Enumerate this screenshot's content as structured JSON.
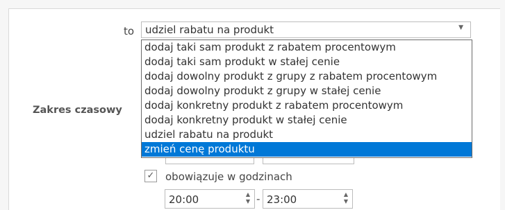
{
  "rule": {
    "to_label": "to",
    "selected_action": "udziel rabatu na produkt",
    "options": [
      "dodaj taki sam produkt z rabatem procentowym",
      "dodaj taki sam produkt w stałej cenie",
      "dodaj dowolny produkt z grupy z rabatem procentowym",
      "dodaj dowolny produkt z grupy w stałej cenie",
      "dodaj konkretny produkt z rabatem procentowym",
      "dodaj konkretny produkt w stałej cenie",
      "udziel rabatu na produkt",
      "zmień cenę produktu"
    ],
    "highlighted_index": 7
  },
  "time_range": {
    "label": "Zakres czasowy",
    "hours_checkbox_label": "obowiązuje w godzinach",
    "hours_checked": true,
    "from": "20:00",
    "separator": "-",
    "to": "23:00"
  },
  "icons": {
    "caret": "chevron-down-icon",
    "check": "checkmark-icon",
    "spinner": "spin-arrows-icon"
  }
}
